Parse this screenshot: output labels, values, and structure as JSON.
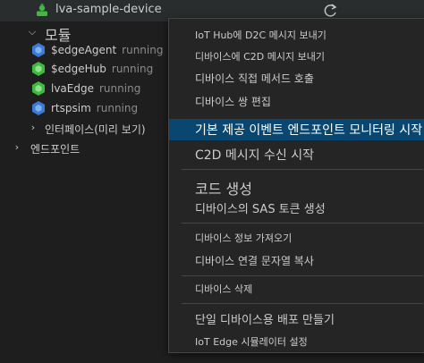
{
  "tree": {
    "device": {
      "label": "lva-sample-device"
    },
    "modules": {
      "label": "모듈"
    },
    "module_items": [
      {
        "name": "$edgeAgent",
        "status": "running",
        "icon_color": "#3c7ad6",
        "icon": "module-blue-icon"
      },
      {
        "name": "$edgeHub",
        "status": "running",
        "icon_color": "#3fb93f",
        "icon": "module-green-icon"
      },
      {
        "name": "lvaEdge",
        "status": "running",
        "icon_color": "#3fb93f",
        "icon": "module-green-icon"
      },
      {
        "name": "rtspsim",
        "status": "running",
        "icon_color": "#3c7ad6",
        "icon": "module-blue-icon"
      }
    ],
    "interfaces": {
      "label": "인터페이스(미리 보기)"
    },
    "endpoints": {
      "label": "엔드포인트"
    }
  },
  "context_menu": {
    "items": [
      {
        "label": "IoT Hub에 D2C 메시지 보내기",
        "active": false
      },
      {
        "label": "디바이스에 C2D 메시지 보내기",
        "active": false
      },
      {
        "label": "디바이스 직접 메서드 호출",
        "active": false
      },
      {
        "label": "디바이스 쌍 편집",
        "active": false
      },
      {
        "label": "기본 제공 이벤트 엔드포인트 모니터링 시작",
        "active": true
      },
      {
        "label": "C2D 메시지 수신 시작",
        "active": false
      },
      {
        "label": "코드 생성",
        "active": false
      },
      {
        "label": "디바이스의 SAS 토큰 생성",
        "active": false
      },
      {
        "label": "디바이스 정보 가져오기",
        "active": false
      },
      {
        "label": "디바이스 연결 문자열 복사",
        "active": false
      },
      {
        "label": "디바이스 삭제",
        "active": false
      },
      {
        "label": "단일 디바이스용 배포 만들기",
        "active": false
      },
      {
        "label": "IoT Edge 시뮬레이터 설정",
        "active": false
      }
    ]
  },
  "colors": {
    "background": "#1e1e1e",
    "menu_background": "#252526",
    "menu_active": "#094771",
    "device_icon": "#3fb93f"
  },
  "icons": {
    "refresh": "refresh-icon",
    "device": "device-icon",
    "chevron_down": "chevron-down-icon",
    "chevron_right": "chevron-right-icon"
  }
}
